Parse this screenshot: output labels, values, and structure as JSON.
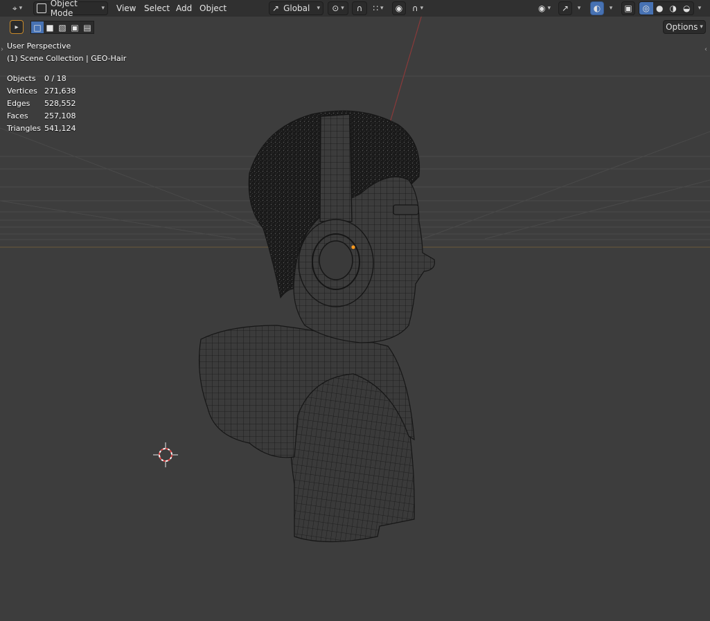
{
  "header": {
    "mode_label": "Object Mode",
    "menus": [
      "View",
      "Select",
      "Add",
      "Object"
    ],
    "orientation_label": "Global",
    "options_label": "Options"
  },
  "overlay": {
    "perspective": "User Perspective",
    "collection": "(1) Scene Collection | GEO-Hair"
  },
  "stats": [
    {
      "label": "Objects",
      "value": "0 / 18"
    },
    {
      "label": "Vertices",
      "value": "271,638"
    },
    {
      "label": "Edges",
      "value": "528,552"
    },
    {
      "label": "Faces",
      "value": "257,108"
    },
    {
      "label": "Triangles",
      "value": "541,124"
    }
  ],
  "colors": {
    "viewport_bg": "#3d3d3d",
    "header_bg": "#303030",
    "accent_blue": "#4772b3",
    "wire": "#161616",
    "grid_line": "#4a4a4a",
    "axis_x_red": "#8a3a3a",
    "horizon": "#6a5a3a",
    "origin_orange": "#ff9a1f",
    "cursor_red": "#e34b4b"
  },
  "icons": [
    "editor-type-icon",
    "object-mode-icon",
    "transform-orientation-icon",
    "pivot-point-icon",
    "snap-icon",
    "snap-target-icon",
    "proportional-edit-icon",
    "falloff-icon",
    "visibility-icon",
    "gizmo-icon",
    "overlay-icon",
    "xray-icon",
    "wireframe-shading-icon",
    "solid-shading-icon",
    "material-shading-icon",
    "rendered-shading-icon",
    "select-tool-icon",
    "select-mode-icons",
    "3d-cursor-icon"
  ]
}
